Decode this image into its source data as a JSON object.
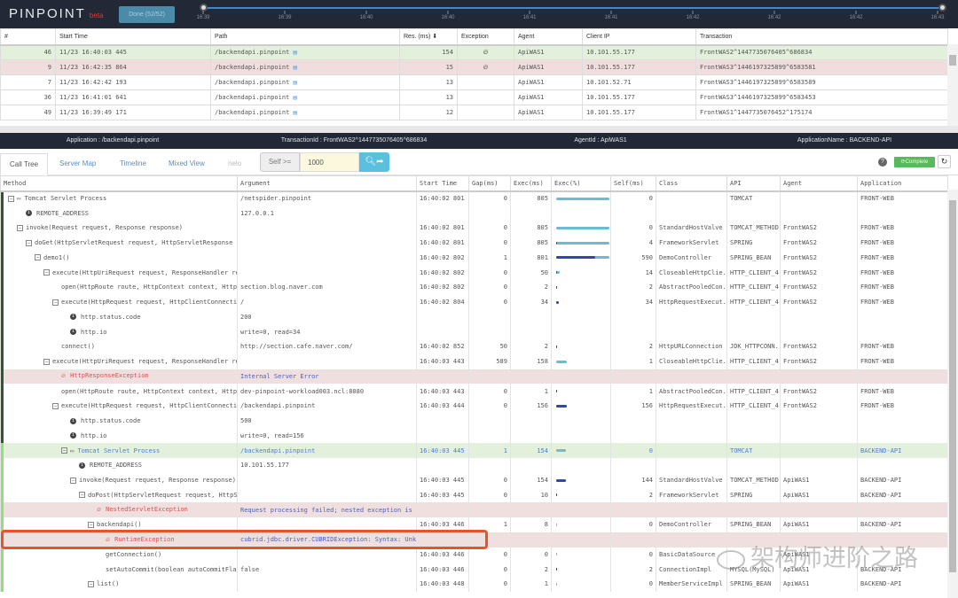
{
  "header": {
    "logo": "PINPOINT",
    "beta": "beta",
    "done_button": "Done (52/52)",
    "timeline_ticks": [
      "16:39",
      "16:39",
      "16:40",
      "16:40",
      "16:41",
      "16:41",
      "16:42",
      "16:42",
      "16:42",
      "16:43"
    ]
  },
  "transactions": {
    "columns": [
      "#",
      "Start Time",
      "Path",
      "Res. (ms) ⬇",
      "Exception",
      "Agent",
      "Client IP",
      "Transaction"
    ],
    "rows": [
      {
        "n": "46",
        "start": "11/23 16:40:03 445",
        "path": "/backendapi.pinpoint",
        "res": "154",
        "exception": true,
        "agent": "ApiWAS1",
        "ip": "10.101.55.177",
        "tx": "FrontWAS2^1447735076405^686834",
        "state": "selected"
      },
      {
        "n": "9",
        "start": "11/23 16:42:35 864",
        "path": "/backendapi.pinpoint",
        "res": "15",
        "exception": true,
        "agent": "ApiWAS1",
        "ip": "10.101.55.177",
        "tx": "FrontWAS3^1446197325899^6583581",
        "state": "error"
      },
      {
        "n": "7",
        "start": "11/23 16:42:42 193",
        "path": "/backendapi.pinpoint",
        "res": "13",
        "exception": false,
        "agent": "ApiWAS1",
        "ip": "10.101.52.71",
        "tx": "FrontWAS3^1446197325899^6583589",
        "state": ""
      },
      {
        "n": "36",
        "start": "11/23 16:41:01 641",
        "path": "/backendapi.pinpoint",
        "res": "13",
        "exception": false,
        "agent": "ApiWAS1",
        "ip": "10.101.55.177",
        "tx": "FrontWAS3^1446197325899^6583453",
        "state": ""
      },
      {
        "n": "49",
        "start": "11/23 16:39:49 171",
        "path": "/backendapi.pinpoint",
        "res": "12",
        "exception": false,
        "agent": "ApiWAS1",
        "ip": "10.101.55.177",
        "tx": "FrontWAS1^1447735076452^175174",
        "state": ""
      }
    ]
  },
  "info": {
    "application": "Application : /backendapi.pinpoint",
    "transaction_id": "TransactionId : FrontWAS2^1447735076405^686834",
    "agent_id": "AgentId : ApiWAS1",
    "application_name": "ApplicationName : BACKEND-API"
  },
  "tabs": [
    {
      "label": "Call Tree",
      "active": true
    },
    {
      "label": "Server Map"
    },
    {
      "label": "Timeline"
    },
    {
      "label": "Mixed View"
    },
    {
      "label": "nelo",
      "dim": true
    }
  ],
  "filter": {
    "label": "Self >=",
    "value": "1000"
  },
  "status": {
    "complete": "Complete"
  },
  "call_tree": {
    "columns": [
      "Method",
      "Argument",
      "Start Time",
      "Gap(ms)",
      "Exec(ms)",
      "Exec(%)",
      "Self(ms)",
      "Class",
      "API",
      "Agent",
      "Application"
    ],
    "max_exec": 805,
    "colors": {
      "front_border": "#2e5a2a",
      "api_border": "#8fe07a",
      "exec_bar": "#6bbbd6",
      "self_bar": "#2d47b0"
    },
    "rows": [
      {
        "lv": 0,
        "kind": "server",
        "toggle": true,
        "method": "Tomcat Servlet Process",
        "arg": "/netspider.pinpoint",
        "start": "16:40:02 801",
        "gap": "0",
        "exec": "805",
        "self": "0",
        "cls": "",
        "api": "TOMCAT",
        "agent": "FrontWAS2",
        "app": "FRONT-WEB"
      },
      {
        "lv": 1,
        "kind": "info",
        "method": "REMOTE_ADDRESS",
        "arg": "127.0.0.1",
        "agent": "FrontWAS2"
      },
      {
        "lv": 1,
        "toggle": true,
        "method": "invoke(Request request, Response response)",
        "arg": "",
        "start": "16:40:02 801",
        "gap": "0",
        "exec": "805",
        "self": "0",
        "cls": "StandardHostValve",
        "api": "TOMCAT_METHOD",
        "agent": "FrontWAS2",
        "app": "FRONT-WEB"
      },
      {
        "lv": 2,
        "toggle": true,
        "method": "doGet(HttpServletRequest request, HttpServletResponse res",
        "arg": "",
        "start": "16:40:02 801",
        "gap": "0",
        "exec": "805",
        "self": "4",
        "cls": "FrameworkServlet",
        "api": "SPRING",
        "agent": "FrontWAS2",
        "app": "FRONT-WEB"
      },
      {
        "lv": 3,
        "toggle": true,
        "method": "demo1()",
        "arg": "",
        "start": "16:40:02 802",
        "gap": "1",
        "exec": "801",
        "self": "590",
        "cls": "DemoController",
        "api": "SPRING_BEAN",
        "agent": "FrontWAS2",
        "app": "FRONT-WEB"
      },
      {
        "lv": 4,
        "toggle": true,
        "method": "execute(HttpUriRequest request, ResponseHandler resp",
        "arg": "",
        "start": "16:40:02 802",
        "gap": "0",
        "exec": "50",
        "self": "14",
        "cls": "CloseableHttpClie..",
        "api": "HTTP_CLIENT_4",
        "agent": "FrontWAS2",
        "app": "FRONT-WEB"
      },
      {
        "lv": 5,
        "method": "open(HttpRoute route, HttpContext context, HttpPa",
        "arg": "section.blog.naver.com",
        "start": "16:40:02 802",
        "gap": "0",
        "exec": "2",
        "self": "2",
        "cls": "AbstractPooledCon..",
        "api": "HTTP_CLIENT_4",
        "agent": "FrontWAS2",
        "app": "FRONT-WEB"
      },
      {
        "lv": 5,
        "toggle": true,
        "method": "execute(HttpRequest request, HttpClientConnection",
        "arg": "/",
        "start": "16:40:02 804",
        "gap": "0",
        "exec": "34",
        "self": "34",
        "cls": "HttpRequestExecut..",
        "api": "HTTP_CLIENT_4",
        "agent": "FrontWAS2",
        "app": "FRONT-WEB"
      },
      {
        "lv": 6,
        "kind": "info",
        "method": "http.status.code",
        "arg": "200",
        "agent": "FrontWAS2"
      },
      {
        "lv": 6,
        "kind": "info",
        "method": "http.io",
        "arg": "write=0, read=34",
        "agent": "FrontWAS2"
      },
      {
        "lv": 5,
        "method": "connect()",
        "arg": "http://section.cafe.naver.com/",
        "start": "16:40:02 852",
        "gap": "50",
        "exec": "2",
        "self": "2",
        "cls": "HttpURLConnection",
        "api": "JDK_HTTPCONN..",
        "agent": "FrontWAS2",
        "app": "FRONT-WEB"
      },
      {
        "lv": 4,
        "toggle": true,
        "method": "execute(HttpUriRequest request, ResponseHandler resp",
        "arg": "",
        "start": "16:40:03 443",
        "gap": "589",
        "exec": "158",
        "self": "1",
        "cls": "CloseableHttpClie..",
        "api": "HTTP_CLIENT_4",
        "agent": "FrontWAS2",
        "app": "FRONT-WEB"
      },
      {
        "lv": 5,
        "kind": "exception",
        "method": "HttpResponseException",
        "arg": "Internal Server Error",
        "agent": "FrontWAS2"
      },
      {
        "lv": 5,
        "method": "open(HttpRoute route, HttpContext context, HttpPa",
        "arg": "dev-pinpoint-workload003.ncl:8080",
        "start": "16:40:03 443",
        "gap": "0",
        "exec": "1",
        "self": "1",
        "cls": "AbstractPooledCon..",
        "api": "HTTP_CLIENT_4",
        "agent": "FrontWAS2",
        "app": "FRONT-WEB"
      },
      {
        "lv": 5,
        "toggle": true,
        "method": "execute(HttpRequest request, HttpClientConnection",
        "arg": "/backendapi.pinpoint",
        "start": "16:40:03 444",
        "gap": "0",
        "exec": "156",
        "self": "156",
        "cls": "HttpRequestExecut..",
        "api": "HTTP_CLIENT_4",
        "agent": "FrontWAS2",
        "app": "FRONT-WEB"
      },
      {
        "lv": 6,
        "kind": "info",
        "method": "http.status.code",
        "arg": "500",
        "agent": "FrontWAS2"
      },
      {
        "lv": 6,
        "kind": "info",
        "method": "http.io",
        "arg": "write=0, read=156",
        "agent": "FrontWAS2"
      },
      {
        "lv": 6,
        "kind": "server",
        "toggle": true,
        "highlight": true,
        "method": "Tomcat Servlet Process",
        "arg": "/backendapi.pinpoint",
        "start": "16:40:03 445",
        "gap": "1",
        "exec": "154",
        "self": "0",
        "cls": "",
        "api": "TOMCAT",
        "agent": "ApiWAS1",
        "app": "BACKEND-API"
      },
      {
        "lv": 7,
        "kind": "info",
        "method": "REMOTE_ADDRESS",
        "arg": "10.101.55.177",
        "agent": "ApiWAS1"
      },
      {
        "lv": 7,
        "toggle": true,
        "method": "invoke(Request request, Response response)",
        "arg": "",
        "start": "16:40:03 445",
        "gap": "0",
        "exec": "154",
        "self": "144",
        "cls": "StandardHostValve",
        "api": "TOMCAT_METHOD",
        "agent": "ApiWAS1",
        "app": "BACKEND-API"
      },
      {
        "lv": 8,
        "toggle": true,
        "method": "doPost(HttpServletRequest request, HttpSer",
        "arg": "",
        "start": "16:40:03 445",
        "gap": "0",
        "exec": "10",
        "self": "2",
        "cls": "FrameworkServlet",
        "api": "SPRING",
        "agent": "ApiWAS1",
        "app": "BACKEND-API"
      },
      {
        "lv": 9,
        "kind": "exception",
        "method": "NestedServletException",
        "arg": "Request processing failed; nested exception is ja",
        "agent": "ApiWAS1"
      },
      {
        "lv": 9,
        "toggle": true,
        "method": "backendapi()",
        "arg": "",
        "start": "16:40:03 446",
        "gap": "1",
        "exec": "8",
        "self": "0",
        "cls": "DemoController",
        "api": "SPRING_BEAN",
        "agent": "ApiWAS1",
        "app": "BACKEND-API"
      },
      {
        "lv": 10,
        "kind": "exception",
        "method": "RuntimeException",
        "arg": "cubrid.jdbc.driver.CUBRIDException: Syntax: Unkno",
        "agent": "ApiWAS1"
      },
      {
        "lv": 10,
        "method": "getConnection()",
        "arg": "",
        "start": "16:40:03 446",
        "gap": "0",
        "exec": "0",
        "self": "0",
        "cls": "BasicDataSource",
        "api": "",
        "agent": "ApiWAS1",
        "app": ""
      },
      {
        "lv": 10,
        "method": "setAutoCommit(boolean autoCommitFlag)",
        "arg": "false",
        "start": "16:40:03 446",
        "gap": "0",
        "exec": "2",
        "self": "2",
        "cls": "ConnectionImpl",
        "api": "MYSQL(MySQL)",
        "agent": "ApiWAS1",
        "app": "BACKEND-API"
      },
      {
        "lv": 9,
        "toggle": true,
        "method": "list()",
        "arg": "",
        "start": "16:40:03 448",
        "gap": "0",
        "exec": "1",
        "self": "0",
        "cls": "MemberServiceImpl",
        "api": "SPRING_BEAN",
        "agent": "ApiWAS1",
        "app": "BACKEND-API"
      }
    ]
  },
  "watermark": "架构师进阶之路"
}
